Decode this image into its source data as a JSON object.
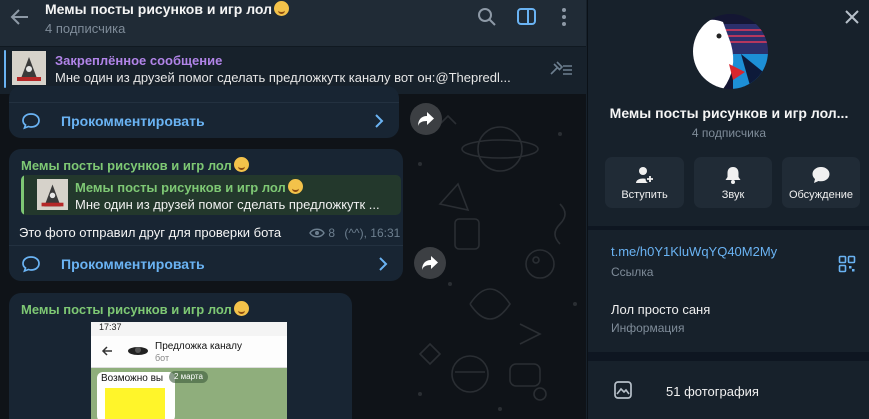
{
  "chat": {
    "title": "Мемы посты рисунков и игр лол",
    "subscribers": "4 подписчика"
  },
  "pinned": {
    "title": "Закреплённое сообщение",
    "text": "Мне один из друзей помог сделать предложкутк каналу вот он:@Thepredl..."
  },
  "comment_label": "Прокомментировать",
  "messages": [
    {
      "author": "Мемы посты рисунков и игр лол",
      "quote_author": "Мемы посты рисунков и игр лол",
      "quote_text": "Мне один из друзей помог сделать предложкутк ...",
      "text": "Это фото отправил друг для проверки бота",
      "views": "8",
      "signature_time": "(^^), 16:31"
    },
    {
      "author": "Мемы посты рисунков и игр лол",
      "phone_time": "17:37",
      "phone_chat_title": "Предложка каналу",
      "phone_chat_sub": "бот",
      "phone_date": "2 марта",
      "phone_msg": "Возможно вы"
    }
  ],
  "panel": {
    "title": "Мемы посты рисунков и игр лол...",
    "subscribers": "4 подписчика",
    "actions": [
      {
        "label": "Вступить",
        "icon": "add-user-icon"
      },
      {
        "label": "Звук",
        "icon": "bell-icon"
      },
      {
        "label": "Обсуждение",
        "icon": "chat-icon"
      }
    ],
    "link": "t.me/h0Y1KluWqYQ40M2My",
    "link_caption": "Ссылка",
    "about": "Лол просто саня",
    "about_caption": "Информация",
    "photos": "51 фотография"
  },
  "colors": {
    "accent": "#6ab3f3",
    "author": "#7ec874",
    "pinned_title": "#b184e8",
    "panel_bg": "#17212b",
    "bubble_bg": "#182533"
  }
}
